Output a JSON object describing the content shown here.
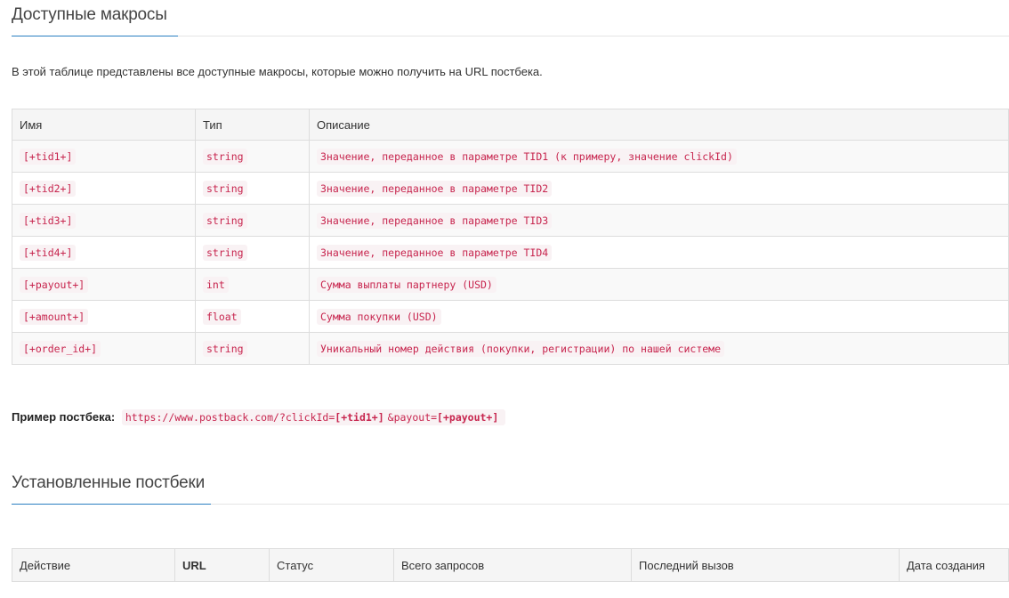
{
  "section1": {
    "title": "Доступные макросы",
    "intro": "В этой таблице представлены все доступные макросы, которые можно получить на URL постбека."
  },
  "macros_table": {
    "headers": [
      "Имя",
      "Тип",
      "Описание"
    ],
    "rows": [
      {
        "name": "[+tid1+]",
        "type": "string",
        "desc": "Значение, переданное в параметре TID1 (к примеру, значение clickId)"
      },
      {
        "name": "[+tid2+]",
        "type": "string",
        "desc": "Значение, переданное в параметре TID2"
      },
      {
        "name": "[+tid3+]",
        "type": "string",
        "desc": "Значение, переданное в параметре TID3"
      },
      {
        "name": "[+tid4+]",
        "type": "string",
        "desc": "Значение, переданное в параметре TID4"
      },
      {
        "name": "[+payout+]",
        "type": "int",
        "desc": "Сумма выплаты партнеру (USD)"
      },
      {
        "name": "[+amount+]",
        "type": "float",
        "desc": "Сумма покупки (USD)"
      },
      {
        "name": "[+order_id+]",
        "type": "string",
        "desc": "Уникальный номер действия (покупки, регистрации) по нашей системе"
      }
    ]
  },
  "example": {
    "label": "Пример постбека:",
    "url_prefix": "https://www.postback.com/?clickId=",
    "macro1": "[+tid1+]",
    "url_mid": "&payout=",
    "macro2": "[+payout+]"
  },
  "section2": {
    "title": "Установленные постбеки"
  },
  "postbacks_table": {
    "headers": [
      "Действие",
      "URL",
      "Статус",
      "Всего запросов",
      "Последний вызов",
      "Дата создания"
    ]
  }
}
